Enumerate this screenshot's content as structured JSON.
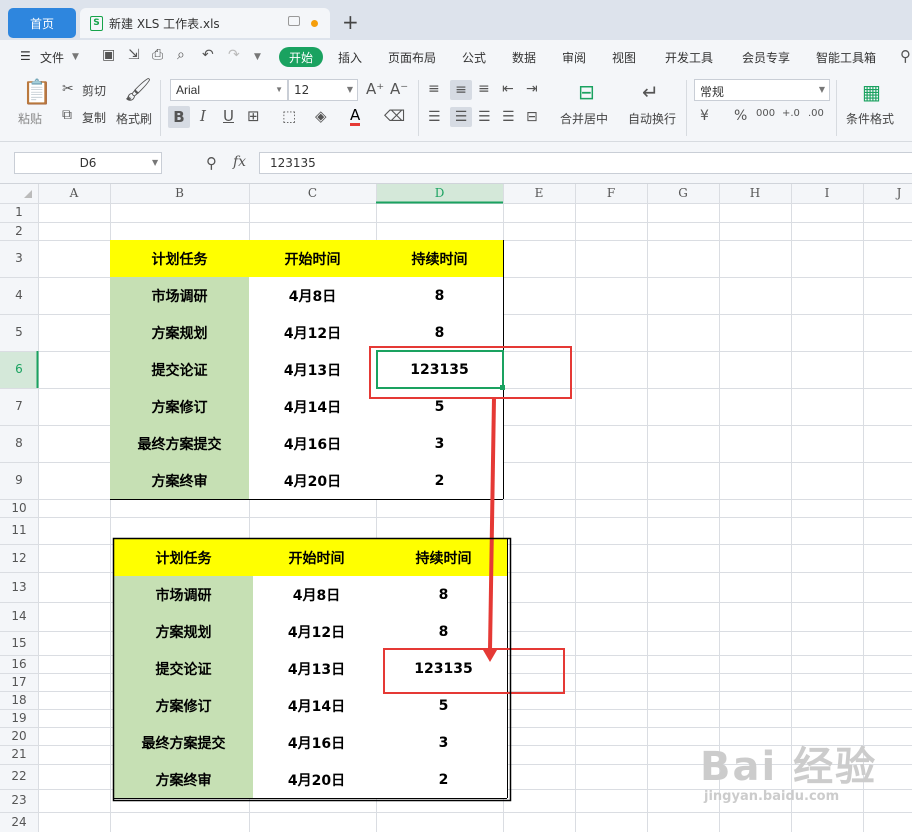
{
  "titlebar": {
    "home_tab": "首页",
    "doc_tab": "新建 XLS 工作表.xls",
    "doc_icon": "S",
    "new_tab": "+"
  },
  "menubar": {
    "file": "文件",
    "items": [
      "开始",
      "插入",
      "页面布局",
      "公式",
      "数据",
      "审阅",
      "视图",
      "开发工具",
      "会员专享",
      "智能工具箱"
    ]
  },
  "ribbon": {
    "paste": "粘贴",
    "cut": "剪切",
    "copy": "复制",
    "format_painter": "格式刷",
    "font_name": "Arial",
    "font_size": "12",
    "merge_center": "合并居中",
    "wrap_text": "自动换行",
    "number_format": "常规",
    "conditional_format": "条件格式",
    "percent": "%",
    "currency": "¥",
    "thousands": "000",
    "dec_inc": "+.0",
    "dec_dec": ".00"
  },
  "formula_bar": {
    "name_box": "D6",
    "fx": "fx",
    "value": "123135"
  },
  "columns": [
    "A",
    "B",
    "C",
    "D",
    "E",
    "F",
    "G",
    "H",
    "I",
    "J"
  ],
  "table1": {
    "headers": [
      "计划任务",
      "开始时间",
      "持续时间"
    ],
    "rows": [
      [
        "市场调研",
        "4月8日",
        "8"
      ],
      [
        "方案规划",
        "4月12日",
        "8"
      ],
      [
        "提交论证",
        "4月13日",
        "123135"
      ],
      [
        "方案修订",
        "4月14日",
        "5"
      ],
      [
        "最终方案提交",
        "4月16日",
        "3"
      ],
      [
        "方案终审",
        "4月20日",
        "2"
      ]
    ]
  },
  "table2": {
    "headers": [
      "计划任务",
      "开始时间",
      "持续时间"
    ],
    "rows": [
      [
        "市场调研",
        "4月8日",
        "8"
      ],
      [
        "方案规划",
        "4月12日",
        "8"
      ],
      [
        "提交论证",
        "4月13日",
        "123135"
      ],
      [
        "方案修订",
        "4月14日",
        "5"
      ],
      [
        "最终方案提交",
        "4月16日",
        "3"
      ],
      [
        "方案终审",
        "4月20日",
        "2"
      ]
    ]
  },
  "colors": {
    "header_yellow": "#ffff00",
    "task_green": "#c6e0b4",
    "highlight_red": "#e53935",
    "selection_green": "#1aa260"
  },
  "watermark": {
    "brand": "Bai 经验",
    "url": "jingyan.baidu.com"
  }
}
